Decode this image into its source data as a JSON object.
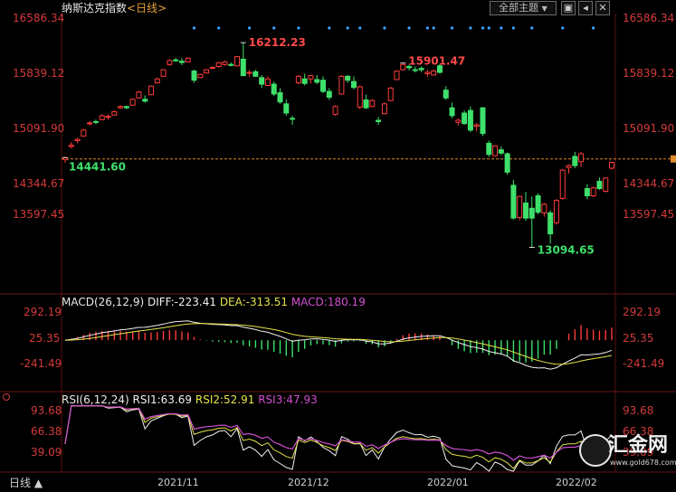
{
  "header": {
    "title": "纳斯达克指数",
    "period_link": "<日线>",
    "theme_button": "全部主题",
    "theme_caret": "▼"
  },
  "toolbar": {
    "icons": [
      "window-icon",
      "back-icon",
      "close-icon"
    ],
    "icon_glyphs": [
      "▣",
      "◂",
      "✕"
    ]
  },
  "colors": {
    "up": "#ff3b3b",
    "down": "#3ee06b",
    "axis_label": "#d33a3a",
    "grid": "#5a0f0f",
    "dif": "#f0f0f0",
    "dea": "#e4e44a",
    "macd": "#d14fd1",
    "rsi1": "#f0f0f0",
    "rsi2": "#e4e44a",
    "rsi3": "#d14fd1",
    "current_price_line": "#e08a2a",
    "event_dots": "#3aa4ff"
  },
  "price_axis": {
    "ticks": [
      "16586.34",
      "15839.12",
      "15091.90",
      "14344.67",
      "13597.45"
    ]
  },
  "macd_axis": {
    "ticks": [
      "292.19",
      "25.35",
      "-241.49"
    ]
  },
  "rsi_axis": {
    "ticks": [
      "93.68",
      "66.38",
      "39.09"
    ]
  },
  "macd_header": {
    "name": "MACD(26,12,9)",
    "dif": "DIFF:-223.41",
    "dea": "DEA:-313.51",
    "macd": "MACD:180.19"
  },
  "rsi_header": {
    "name": "RSI(6,12,24)",
    "rsi1": "RSI1:63.69",
    "rsi2": "RSI2:52.91",
    "rsi3": "RSI3:47.93"
  },
  "x_axis": {
    "period_label": "日线 ▲",
    "labels": [
      "2021/11",
      "2021/12",
      "2022/01",
      "2022/02"
    ]
  },
  "watermark": {
    "brand": "汇金网",
    "url": "www.gold678.com"
  },
  "chart_data": [
    {
      "type": "candlestick",
      "title": "纳斯达克指数",
      "ylim": [
        13094.65,
        16586.34
      ],
      "last_price": 14441.6,
      "annotations": [
        {
          "label": "16212.23",
          "kind": "high"
        },
        {
          "label": "15901.47",
          "kind": "high"
        },
        {
          "label": "14441.60",
          "kind": "start"
        },
        {
          "label": "13094.65",
          "kind": "low"
        }
      ],
      "candles": [
        [
          14430,
          14480,
          14380,
          14460
        ],
        [
          14630,
          14700,
          14600,
          14650
        ],
        [
          14720,
          14760,
          14680,
          14740
        ],
        [
          14790,
          14900,
          14780,
          14880
        ],
        [
          14980,
          15020,
          14950,
          14990
        ],
        [
          15010,
          15040,
          14970,
          15000
        ],
        [
          15040,
          15120,
          15030,
          15100
        ],
        [
          15080,
          15120,
          15040,
          15090
        ],
        [
          15110,
          15180,
          15100,
          15160
        ],
        [
          15220,
          15260,
          15200,
          15240
        ],
        [
          15240,
          15250,
          15200,
          15220
        ],
        [
          15260,
          15360,
          15250,
          15350
        ],
        [
          15370,
          15480,
          15360,
          15460
        ],
        [
          15350,
          15410,
          15300,
          15320
        ],
        [
          15420,
          15560,
          15410,
          15550
        ],
        [
          15600,
          15680,
          15590,
          15660
        ],
        [
          15700,
          15810,
          15690,
          15800
        ],
        [
          15880,
          15960,
          15860,
          15940
        ],
        [
          15950,
          15980,
          15920,
          15935
        ],
        [
          15930,
          15980,
          15870,
          15910
        ],
        [
          15920,
          15990,
          15910,
          15975
        ],
        [
          15780,
          15800,
          15600,
          15640
        ],
        [
          15680,
          15740,
          15670,
          15730
        ],
        [
          15750,
          15810,
          15740,
          15800
        ],
        [
          15830,
          15850,
          15810,
          15835
        ],
        [
          15850,
          15920,
          15830,
          15905
        ],
        [
          15880,
          15940,
          15860,
          15920
        ],
        [
          15880,
          15910,
          15850,
          15865
        ],
        [
          15860,
          16010,
          15850,
          16000
        ],
        [
          15960,
          16212.23,
          15820,
          15710
        ],
        [
          15750,
          15800,
          15690,
          15760
        ],
        [
          15770,
          15800,
          15690,
          15700
        ],
        [
          15680,
          15720,
          15520,
          15580
        ],
        [
          15560,
          15700,
          15550,
          15660
        ],
        [
          15580,
          15620,
          15400,
          15430
        ],
        [
          15450,
          15520,
          15280,
          15310
        ],
        [
          15280,
          15350,
          15100,
          15140
        ],
        [
          15060,
          15100,
          14960,
          15050
        ],
        [
          15600,
          15720,
          15580,
          15700
        ],
        [
          15660,
          15740,
          15560,
          15590
        ],
        [
          15660,
          15720,
          15590,
          15710
        ],
        [
          15650,
          15720,
          15580,
          15610
        ],
        [
          15640,
          15700,
          15440,
          15470
        ],
        [
          15470,
          15520,
          15340,
          15380
        ],
        [
          15120,
          15260,
          15100,
          15240
        ],
        [
          15430,
          15720,
          15420,
          15700
        ],
        [
          15700,
          15720,
          15600,
          15640
        ],
        [
          15620,
          15700,
          15500,
          15530
        ],
        [
          15230,
          15560,
          15200,
          15540
        ],
        [
          15340,
          15420,
          15200,
          15220
        ],
        [
          15240,
          15350,
          15230,
          15330
        ],
        [
          15030,
          15080,
          14960,
          15010
        ],
        [
          15130,
          15300,
          15120,
          15280
        ],
        [
          15330,
          15540,
          15320,
          15520
        ],
        [
          15650,
          15790,
          15640,
          15780
        ],
        [
          15800,
          15901.47,
          15790,
          15880
        ],
        [
          15850,
          15880,
          15790,
          15830
        ],
        [
          15800,
          15850,
          15760,
          15790
        ],
        [
          15820,
          15850,
          15760,
          15800
        ],
        [
          15740,
          15800,
          15690,
          15760
        ],
        [
          15720,
          15800,
          15710,
          15780
        ],
        [
          15860,
          15890,
          15740,
          15760
        ],
        [
          15490,
          15550,
          15340,
          15370
        ],
        [
          15220,
          15300,
          15060,
          15100
        ],
        [
          15000,
          15060,
          14950,
          15030
        ],
        [
          15140,
          15180,
          14960,
          14980
        ],
        [
          15180,
          15240,
          14850,
          14880
        ],
        [
          14940,
          14990,
          14860,
          14960
        ],
        [
          15220,
          15230,
          14790,
          14830
        ],
        [
          14680,
          14720,
          14470,
          14510
        ],
        [
          14490,
          14650,
          14480,
          14640
        ],
        [
          14580,
          14630,
          14500,
          14530
        ],
        [
          14520,
          14540,
          14200,
          14240
        ],
        [
          14040,
          14120,
          13520,
          13540
        ],
        [
          13550,
          13880,
          13510,
          13870
        ],
        [
          13770,
          13940,
          13500,
          13540
        ],
        [
          13690,
          13870,
          13094.65,
          13540
        ],
        [
          13880,
          13920,
          13600,
          13630
        ],
        [
          13620,
          13770,
          13560,
          13750
        ],
        [
          13620,
          13660,
          13150,
          13300
        ],
        [
          13470,
          13830,
          13440,
          13810
        ],
        [
          13840,
          14290,
          13820,
          14270
        ],
        [
          14310,
          14360,
          14220,
          14340
        ],
        [
          14480,
          14550,
          14300,
          14340
        ],
        [
          14400,
          14550,
          14320,
          14520
        ],
        [
          13990,
          14060,
          13830,
          13880
        ],
        [
          13880,
          14020,
          13860,
          14000
        ],
        [
          14100,
          14160,
          13970,
          13990
        ],
        [
          13950,
          14160,
          13930,
          14150
        ],
        [
          14300,
          14400,
          14280,
          14390
        ]
      ]
    },
    {
      "type": "bar",
      "title": "MACD(26,12,9)",
      "ylim": [
        -241.49,
        292.19
      ],
      "dif_last": -223.41,
      "dea_last": -313.51,
      "macd_last": 180.19
    },
    {
      "type": "line",
      "title": "RSI(6,12,24)",
      "ylim": [
        39.09,
        93.68
      ],
      "rsi1_last": 63.69,
      "rsi2_last": 52.91,
      "rsi3_last": 47.93
    }
  ]
}
